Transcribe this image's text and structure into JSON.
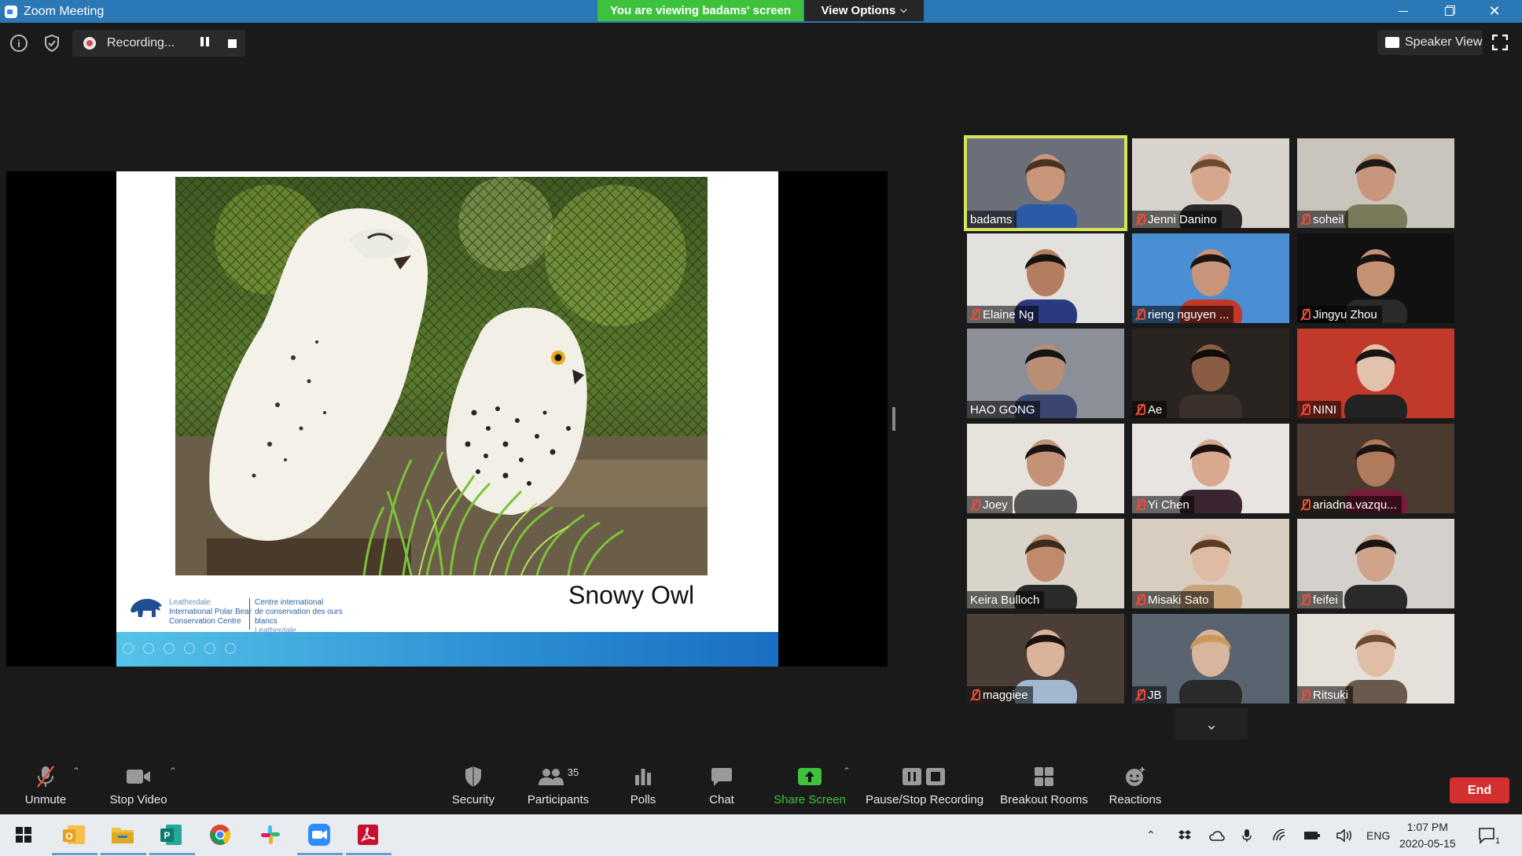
{
  "window": {
    "title": "Zoom Meeting"
  },
  "banner": {
    "viewing": "You are viewing badams' screen",
    "view_options": "View Options"
  },
  "top": {
    "recording": "Recording...",
    "speaker_view": "Speaker View"
  },
  "slide": {
    "title": "Snowy Owl",
    "logo_en": [
      "Leatherdale",
      "International Polar Bear",
      "Conservation Centre"
    ],
    "logo_fr": [
      "Centre international",
      "de conservation des ours blancs",
      "Leatherdale"
    ]
  },
  "participants": [
    {
      "name": "badams",
      "muted": false,
      "active": true,
      "bg": "#6b6f7a",
      "skin": "#c9967a",
      "shirt": "#2b5aa8",
      "hair": "#4a3220"
    },
    {
      "name": "Jenni Danino",
      "muted": true,
      "bg": "#d8d3cc",
      "skin": "#d6a68d",
      "shirt": "#2a2a2a",
      "hair": "#6b4a2f"
    },
    {
      "name": "soheil",
      "muted": true,
      "bg": "#c9c5bd",
      "skin": "#c8967a",
      "shirt": "#7a7a5a",
      "hair": "#1e1a18"
    },
    {
      "name": "Elaine Ng",
      "muted": true,
      "bg": "#e3e1de",
      "skin": "#b57d60",
      "shirt": "#2a3a80",
      "hair": "#141210"
    },
    {
      "name": "rieng nguyen ...",
      "muted": true,
      "bg": "#4a8fd4",
      "skin": "#c89579",
      "shirt": "#c0392b",
      "hair": "#1c1410"
    },
    {
      "name": "Jingyu Zhou",
      "muted": true,
      "bg": "#111111",
      "skin": "#c49273",
      "shirt": "#2a2a2a",
      "hair": "#161210"
    },
    {
      "name": "HAO GONG",
      "muted": false,
      "bg": "#8a8f98",
      "skin": "#b98e74",
      "shirt": "#3a4670",
      "hair": "#141414"
    },
    {
      "name": "Ae",
      "muted": true,
      "bg": "#2a2420",
      "skin": "#8a5c44",
      "shirt": "#3a2f2a",
      "hair": "#0f0c0a"
    },
    {
      "name": "NINI",
      "muted": true,
      "bg": "#c0392b",
      "skin": "#e2c1ad",
      "shirt": "#222222",
      "hair": "#1a1412"
    },
    {
      "name": "Joey",
      "muted": true,
      "bg": "#e6e2dc",
      "skin": "#c49277",
      "shirt": "#555555",
      "hair": "#181412"
    },
    {
      "name": "Yi Chen",
      "muted": true,
      "bg": "#e8e4e1",
      "skin": "#d8a98f",
      "shirt": "#3a2430",
      "hair": "#1a1210"
    },
    {
      "name": "ariadna.vazqu...",
      "muted": true,
      "bg": "#4a3a30",
      "skin": "#b07a5c",
      "shirt": "#7a1a3a",
      "hair": "#1c1412"
    },
    {
      "name": "Keira Bulloch",
      "muted": false,
      "bg": "#d8d4ca",
      "skin": "#c08a6c",
      "shirt": "#2a2a2a",
      "hair": "#3a2a1e"
    },
    {
      "name": "Misaki Sato",
      "muted": true,
      "bg": "#d9cdbf",
      "skin": "#e0bba3",
      "shirt": "#c9a47a",
      "hair": "#5a3a24"
    },
    {
      "name": "feifei",
      "muted": true,
      "bg": "#d4d0cb",
      "skin": "#d0a48a",
      "shirt": "#2a2a2a",
      "hair": "#1a1412"
    },
    {
      "name": "maggiee",
      "muted": true,
      "bg": "#4a3e36",
      "skin": "#d9b39a",
      "shirt": "#a0b8d0",
      "hair": "#1a1210"
    },
    {
      "name": "JB",
      "muted": true,
      "bg": "#5a6470",
      "skin": "#d8b69e",
      "shirt": "#2a2a2a",
      "hair": "#c99a5a"
    },
    {
      "name": "Ritsuki",
      "muted": true,
      "bg": "#e6e0da",
      "skin": "#e0bea6",
      "shirt": "#6a5a4e",
      "hair": "#6a4a32"
    }
  ],
  "toolbar": {
    "unmute": "Unmute",
    "stop_video": "Stop Video",
    "security": "Security",
    "participants": "Participants",
    "participants_count": "35",
    "polls": "Polls",
    "chat": "Chat",
    "share_screen": "Share Screen",
    "pause_stop_recording": "Pause/Stop Recording",
    "breakout_rooms": "Breakout Rooms",
    "reactions": "Reactions",
    "end": "End"
  },
  "taskbar": {
    "language": "ENG",
    "time": "1:07 PM",
    "date": "2020-05-15",
    "notification_count": "1"
  },
  "colors": {
    "accent": "#2d8cff",
    "share_green": "#3ec23e",
    "end_red": "#d32f2f",
    "active_speaker": "#d7e35a"
  }
}
